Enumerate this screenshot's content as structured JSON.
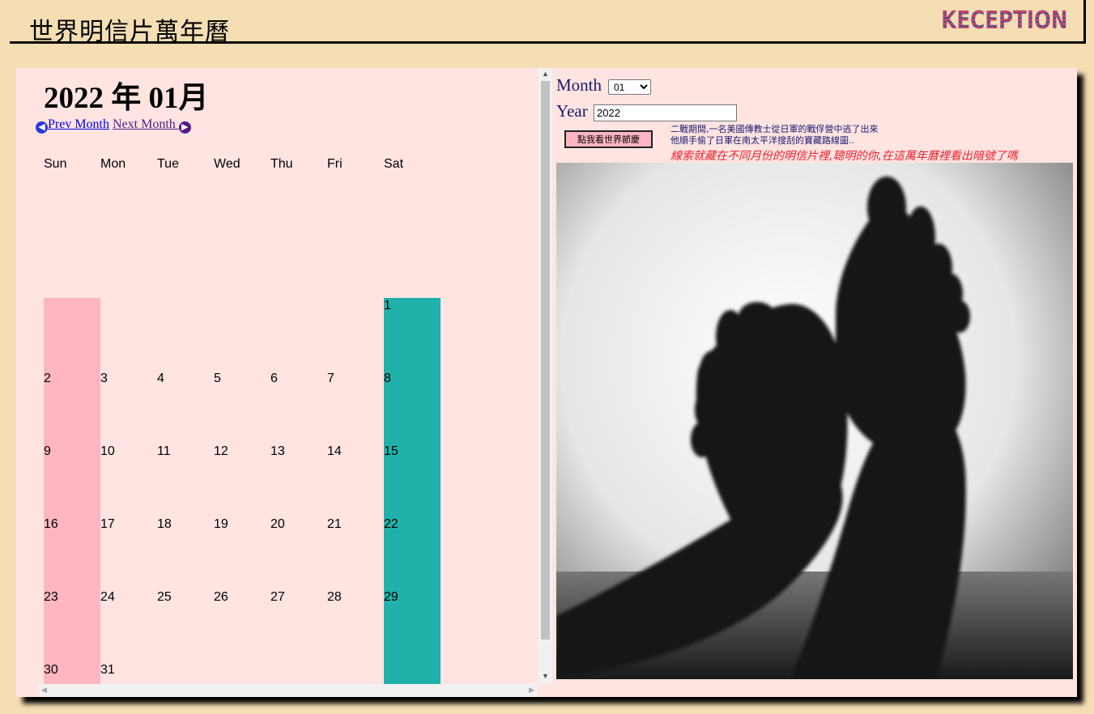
{
  "header": {
    "title": "世界明信片萬年曆",
    "logo_text": "KECEPTION"
  },
  "calendar": {
    "heading": "2022 年 01月",
    "prev_label": "Prev Month",
    "next_label": "Next Month ",
    "weekdays": [
      "Sun",
      "Mon",
      "Tue",
      "Wed",
      "Thu",
      "Fri",
      "Sat"
    ],
    "weeks": [
      [
        "",
        "",
        "",
        "",
        "",
        "",
        "1"
      ],
      [
        "2",
        "3",
        "4",
        "5",
        "6",
        "7",
        "8"
      ],
      [
        "9",
        "10",
        "11",
        "12",
        "13",
        "14",
        "15"
      ],
      [
        "16",
        "17",
        "18",
        "19",
        "20",
        "21",
        "22"
      ],
      [
        "23",
        "24",
        "25",
        "26",
        "27",
        "28",
        "29"
      ],
      [
        "30",
        "31",
        "",
        "",
        "",
        "",
        ""
      ]
    ],
    "sunday_color": "#ffb6c1",
    "saturday_color": "#20b2aa"
  },
  "controls": {
    "month_label": "Month",
    "month_value": "01",
    "year_label": "Year",
    "year_value": "2022",
    "button_label": "點我看世界節慶"
  },
  "story": {
    "line1": "二戰期間,一名美國傳教士從日軍的戰俘營中逃了出來",
    "line2": "他順手偷了日軍在南太平洋搜刮的寶藏路線圖..",
    "hint": "線索就藏在不同月份的明信片裡,聰明的你,在這萬年曆裡看出暗號了嗎"
  },
  "colors": {
    "page_bg": "#f5deb3",
    "panel_bg": "#ffe4e1",
    "label_color": "#191970",
    "hint_color": "#e8232f"
  },
  "image": {
    "alt": "black-and-white photo of bare feet"
  }
}
